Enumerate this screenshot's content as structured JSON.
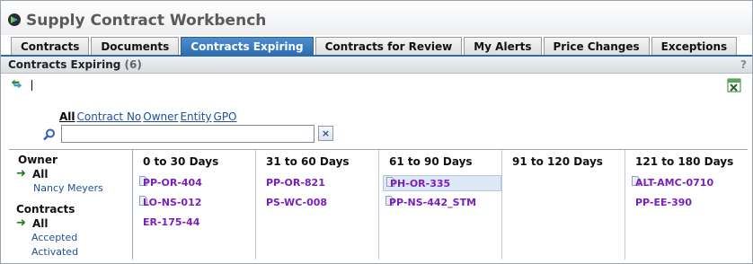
{
  "app": {
    "title": "Supply Contract Workbench"
  },
  "tabs": [
    {
      "label": "Contracts",
      "active": false
    },
    {
      "label": "Documents",
      "active": false
    },
    {
      "label": "Contracts Expiring",
      "active": true
    },
    {
      "label": "Contracts for Review",
      "active": false
    },
    {
      "label": "My Alerts",
      "active": false
    },
    {
      "label": "Price Changes",
      "active": false
    },
    {
      "label": "Exceptions",
      "active": false
    }
  ],
  "panel": {
    "title": "Contracts Expiring",
    "count": "(6)",
    "help": "?"
  },
  "toolbar": {
    "refresh_icon": "refresh-arrows-icon",
    "export_icon": "excel-icon"
  },
  "filter": {
    "links": [
      "All",
      "Contract No",
      "Owner",
      "Entity",
      "GPO"
    ],
    "selected": "All",
    "search_value": "",
    "clear_label": "×"
  },
  "sidebar": {
    "owner_heading": "Owner",
    "owner_all": "All",
    "owner_items": [
      "Nancy Meyers"
    ],
    "contracts_heading": "Contracts",
    "contracts_all": "All",
    "contracts_items": [
      "Accepted",
      "Activated"
    ]
  },
  "columns": [
    {
      "header": "0 to 30 Days",
      "items": [
        {
          "id": "PP-OR-404",
          "icon": true,
          "selected": false
        },
        {
          "id": "LO-NS-012",
          "icon": true,
          "selected": false
        },
        {
          "id": "ER-175-44",
          "icon": false,
          "selected": false
        }
      ]
    },
    {
      "header": "31 to 60 Days",
      "items": [
        {
          "id": "PP-OR-821",
          "icon": false,
          "selected": false
        },
        {
          "id": "PS-WC-008",
          "icon": false,
          "selected": false
        }
      ]
    },
    {
      "header": "61 to 90 Days",
      "items": [
        {
          "id": "PH-OR-335",
          "icon": true,
          "selected": true
        },
        {
          "id": "PP-NS-442_STM",
          "icon": true,
          "selected": false
        }
      ]
    },
    {
      "header": "91 to 120 Days",
      "items": []
    },
    {
      "header": "121 to 180 Days",
      "items": [
        {
          "id": "ALT-AMC-0710",
          "icon": true,
          "selected": false
        },
        {
          "id": "PP-EE-390",
          "icon": false,
          "selected": false
        }
      ]
    }
  ],
  "colors": {
    "tab_active": "#2c6bb0",
    "contract_link": "#7a1fbf",
    "link": "#1f4f9c"
  }
}
